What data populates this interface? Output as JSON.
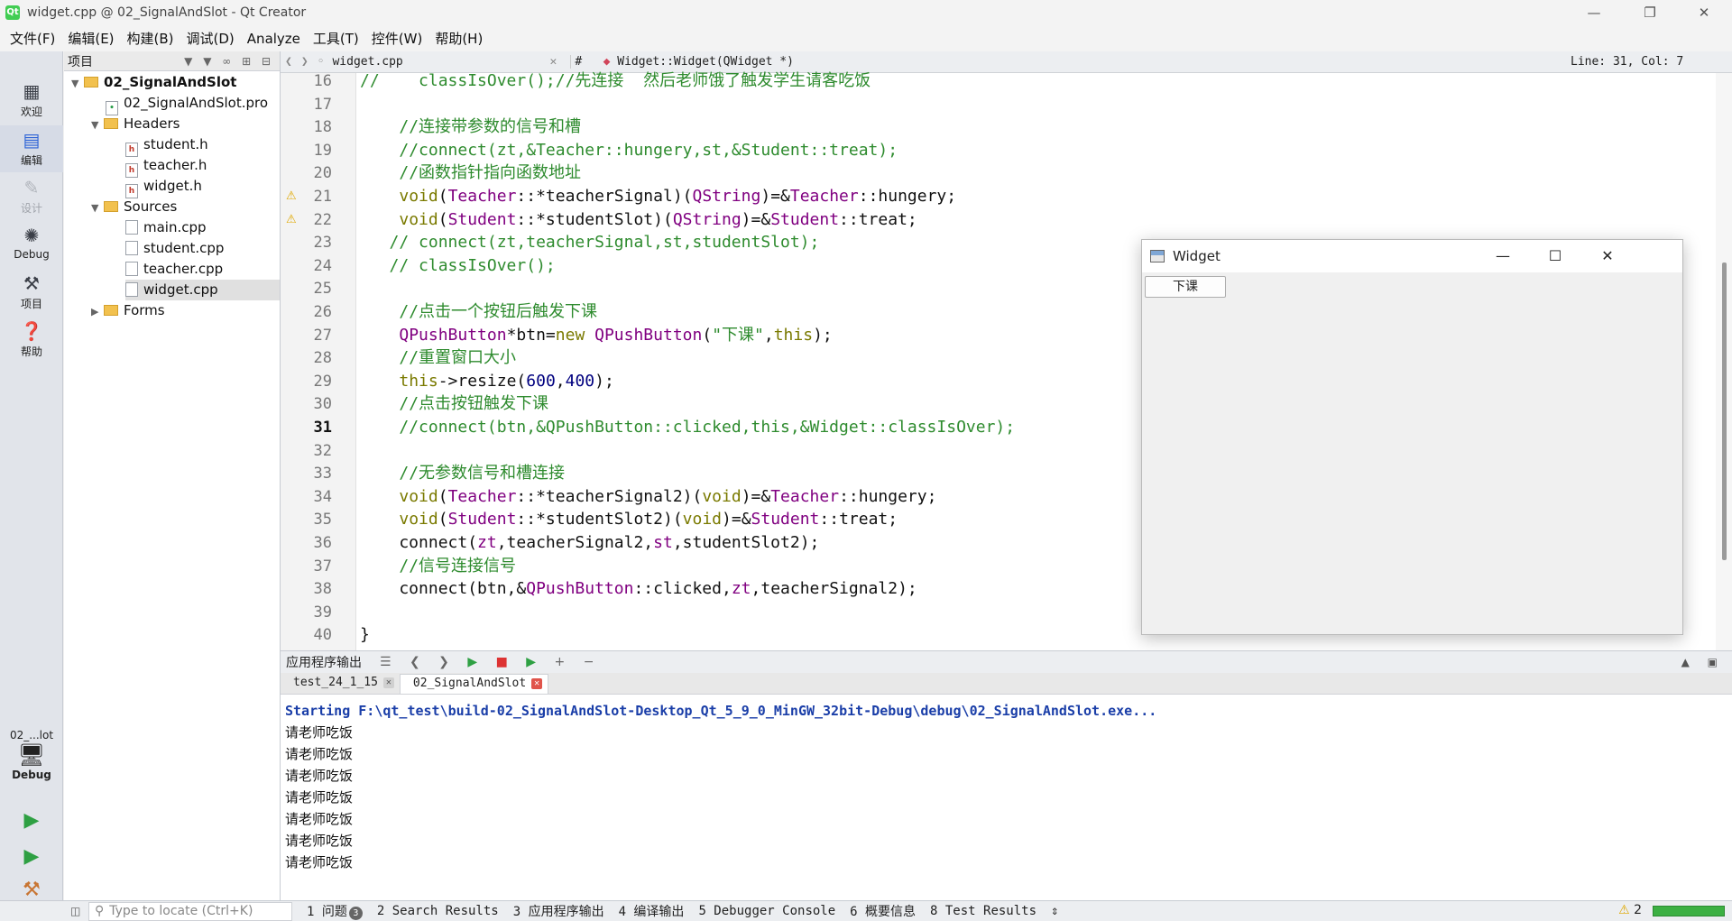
{
  "window": {
    "title": "widget.cpp @ 02_SignalAndSlot - Qt Creator",
    "minimize": "—",
    "maximize": "❐",
    "close": "✕"
  },
  "menu": [
    "文件(F)",
    "编辑(E)",
    "构建(B)",
    "调试(D)",
    "Analyze",
    "工具(T)",
    "控件(W)",
    "帮助(H)"
  ],
  "modes": [
    {
      "label": "欢迎",
      "icon": "grid-icon"
    },
    {
      "label": "编辑",
      "icon": "edit-icon"
    },
    {
      "label": "设计",
      "icon": "design-icon"
    },
    {
      "label": "Debug",
      "icon": "bug-icon"
    },
    {
      "label": "项目",
      "icon": "wrench-icon"
    },
    {
      "label": "帮助",
      "icon": "help-icon"
    }
  ],
  "kit": {
    "name": "02_...lot",
    "mode": "Debug"
  },
  "projects": {
    "title": "项目",
    "tree": [
      {
        "label": "02_SignalAndSlot",
        "type": "project"
      },
      {
        "label": "02_SignalAndSlot.pro",
        "type": "pro"
      },
      {
        "label": "Headers",
        "type": "folder"
      },
      {
        "label": "student.h",
        "type": "header"
      },
      {
        "label": "teacher.h",
        "type": "header"
      },
      {
        "label": "widget.h",
        "type": "header"
      },
      {
        "label": "Sources",
        "type": "folder"
      },
      {
        "label": "main.cpp",
        "type": "source"
      },
      {
        "label": "student.cpp",
        "type": "source"
      },
      {
        "label": "teacher.cpp",
        "type": "source"
      },
      {
        "label": "widget.cpp",
        "type": "source",
        "selected": true
      },
      {
        "label": "Forms",
        "type": "folder"
      }
    ]
  },
  "editor": {
    "file": "widget.cpp",
    "hash": "#",
    "symbol": "Widget::Widget(QWidget *)",
    "line_col": "Line: 31, Col: 7",
    "current_line": 31,
    "warning_lines": [
      21,
      22
    ],
    "lines": [
      {
        "n": 16,
        "t": "//    classIsOver();//先连接  然后老师饿了触发学生请客吃饭"
      },
      {
        "n": 17,
        "t": ""
      },
      {
        "n": 18,
        "t": "    //连接带参数的信号和槽"
      },
      {
        "n": 19,
        "t": "    //connect(zt,&Teacher::hungery,st,&Student::treat);"
      },
      {
        "n": 20,
        "t": "    //函数指针指向函数地址"
      },
      {
        "n": 21,
        "t": "    void(Teacher::*teacherSignal)(QString)=&Teacher::hungery;"
      },
      {
        "n": 22,
        "t": "    void(Student::*studentSlot)(QString)=&Student::treat;"
      },
      {
        "n": 23,
        "t": "   // connect(zt,teacherSignal,st,studentSlot);"
      },
      {
        "n": 24,
        "t": "   // classIsOver();"
      },
      {
        "n": 25,
        "t": ""
      },
      {
        "n": 26,
        "t": "    //点击一个按钮后触发下课"
      },
      {
        "n": 27,
        "t": "    QPushButton*btn=new QPushButton(\"下课\",this);"
      },
      {
        "n": 28,
        "t": "    //重置窗口大小"
      },
      {
        "n": 29,
        "t": "    this->resize(600,400);"
      },
      {
        "n": 30,
        "t": "    //点击按钮触发下课"
      },
      {
        "n": 31,
        "t": "    //connect(btn,&QPushButton::clicked,this,&Widget::classIsOver);"
      },
      {
        "n": 32,
        "t": ""
      },
      {
        "n": 33,
        "t": "    //无参数信号和槽连接"
      },
      {
        "n": 34,
        "t": "    void(Teacher::*teacherSignal2)(void)=&Teacher::hungery;"
      },
      {
        "n": 35,
        "t": "    void(Student::*studentSlot2)(void)=&Student::treat;"
      },
      {
        "n": 36,
        "t": "    connect(zt,teacherSignal2,st,studentSlot2);"
      },
      {
        "n": 37,
        "t": "    //信号连接信号"
      },
      {
        "n": 38,
        "t": "    connect(btn,&QPushButton::clicked,zt,teacherSignal2);"
      },
      {
        "n": 39,
        "t": ""
      },
      {
        "n": 40,
        "t": "}"
      }
    ]
  },
  "widget_window": {
    "title": "Widget",
    "button": "下课"
  },
  "output": {
    "title": "应用程序输出",
    "tabs": [
      {
        "label": "test_24_1_15",
        "active": false
      },
      {
        "label": "02_SignalAndSlot",
        "active": true
      }
    ],
    "starting": "Starting F:\\qt_test\\build-02_SignalAndSlot-Desktop_Qt_5_9_0_MinGW_32bit-Debug\\debug\\02_SignalAndSlot.exe...",
    "lines": [
      "请老师吃饭",
      "请老师吃饭",
      "请老师吃饭",
      "请老师吃饭",
      "请老师吃饭",
      "请老师吃饭",
      "请老师吃饭"
    ]
  },
  "statusbar": {
    "locate_placeholder": "Type to locate (Ctrl+K)",
    "tabs": [
      {
        "label": "1 问题",
        "badge": "3"
      },
      {
        "label": "2 Search Results"
      },
      {
        "label": "3 应用程序输出"
      },
      {
        "label": "4 编译输出"
      },
      {
        "label": "5 Debugger Console"
      },
      {
        "label": "6 概要信息"
      },
      {
        "label": "8 Test Results"
      }
    ],
    "warnings": "2"
  }
}
